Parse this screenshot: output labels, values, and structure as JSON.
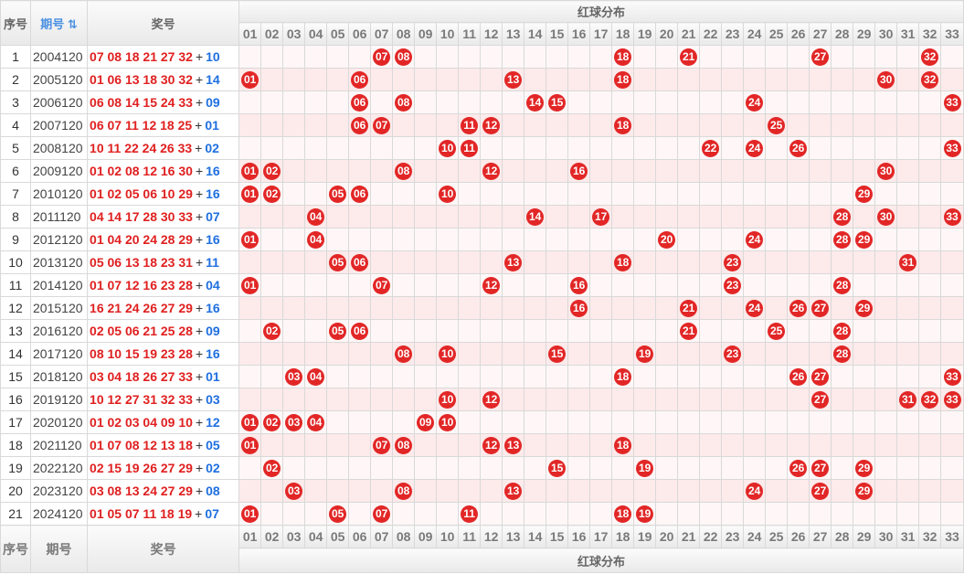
{
  "header": {
    "seq": "序号",
    "period": "期号",
    "sort_icon": "⇅",
    "numbers": "奖号",
    "group": "红球分布"
  },
  "columns": [
    "01",
    "02",
    "03",
    "04",
    "05",
    "06",
    "07",
    "08",
    "09",
    "10",
    "11",
    "12",
    "13",
    "14",
    "15",
    "16",
    "17",
    "18",
    "19",
    "20",
    "21",
    "22",
    "23",
    "24",
    "25",
    "26",
    "27",
    "28",
    "29",
    "30",
    "31",
    "32",
    "33"
  ],
  "separators_after": [
    11,
    22
  ],
  "rows": [
    {
      "seq": "1",
      "period": "2004120",
      "red": "07 08 18 21 27 32",
      "blue": "10",
      "balls": [
        "07",
        "08",
        "18",
        "21",
        "27",
        "32"
      ]
    },
    {
      "seq": "2",
      "period": "2005120",
      "red": "01 06 13 18 30 32",
      "blue": "14",
      "balls": [
        "01",
        "06",
        "13",
        "18",
        "30",
        "32"
      ]
    },
    {
      "seq": "3",
      "period": "2006120",
      "red": "06 08 14 15 24 33",
      "blue": "09",
      "balls": [
        "06",
        "08",
        "14",
        "15",
        "24",
        "33"
      ]
    },
    {
      "seq": "4",
      "period": "2007120",
      "red": "06 07 11 12 18 25",
      "blue": "01",
      "balls": [
        "06",
        "07",
        "11",
        "12",
        "18",
        "25"
      ]
    },
    {
      "seq": "5",
      "period": "2008120",
      "red": "10 11 22 24 26 33",
      "blue": "02",
      "balls": [
        "10",
        "11",
        "22",
        "24",
        "26",
        "33"
      ]
    },
    {
      "seq": "6",
      "period": "2009120",
      "red": "01 02 08 12 16 30",
      "blue": "16",
      "balls": [
        "01",
        "02",
        "08",
        "12",
        "16",
        "30"
      ]
    },
    {
      "seq": "7",
      "period": "2010120",
      "red": "01 02 05 06 10 29",
      "blue": "16",
      "balls": [
        "01",
        "02",
        "05",
        "06",
        "10",
        "29"
      ]
    },
    {
      "seq": "8",
      "period": "2011120",
      "red": "04 14 17 28 30 33",
      "blue": "07",
      "balls": [
        "04",
        "14",
        "17",
        "28",
        "30",
        "33"
      ]
    },
    {
      "seq": "9",
      "period": "2012120",
      "red": "01 04 20 24 28 29",
      "blue": "16",
      "balls": [
        "01",
        "04",
        "20",
        "24",
        "28",
        "29"
      ]
    },
    {
      "seq": "10",
      "period": "2013120",
      "red": "05 06 13 18 23 31",
      "blue": "11",
      "balls": [
        "05",
        "06",
        "13",
        "18",
        "23",
        "31"
      ]
    },
    {
      "seq": "11",
      "period": "2014120",
      "red": "01 07 12 16 23 28",
      "blue": "04",
      "balls": [
        "01",
        "07",
        "12",
        "16",
        "23",
        "28"
      ]
    },
    {
      "seq": "12",
      "period": "2015120",
      "red": "16 21 24 26 27 29",
      "blue": "16",
      "balls": [
        "16",
        "21",
        "24",
        "26",
        "27",
        "29"
      ]
    },
    {
      "seq": "13",
      "period": "2016120",
      "red": "02 05 06 21 25 28",
      "blue": "09",
      "balls": [
        "02",
        "05",
        "06",
        "21",
        "25",
        "28"
      ]
    },
    {
      "seq": "14",
      "period": "2017120",
      "red": "08 10 15 19 23 28",
      "blue": "16",
      "balls": [
        "08",
        "10",
        "15",
        "19",
        "23",
        "28"
      ]
    },
    {
      "seq": "15",
      "period": "2018120",
      "red": "03 04 18 26 27 33",
      "blue": "01",
      "balls": [
        "03",
        "04",
        "18",
        "26",
        "27",
        "33"
      ]
    },
    {
      "seq": "16",
      "period": "2019120",
      "red": "10 12 27 31 32 33",
      "blue": "03",
      "balls": [
        "10",
        "12",
        "27",
        "31",
        "32",
        "33"
      ]
    },
    {
      "seq": "17",
      "period": "2020120",
      "red": "01 02 03 04 09 10",
      "blue": "12",
      "balls": [
        "01",
        "02",
        "03",
        "04",
        "09",
        "10"
      ]
    },
    {
      "seq": "18",
      "period": "2021120",
      "red": "01 07 08 12 13 18",
      "blue": "05",
      "balls": [
        "01",
        "07",
        "08",
        "12",
        "13",
        "18"
      ]
    },
    {
      "seq": "19",
      "period": "2022120",
      "red": "02 15 19 26 27 29",
      "blue": "02",
      "balls": [
        "02",
        "15",
        "19",
        "26",
        "27",
        "29"
      ]
    },
    {
      "seq": "20",
      "period": "2023120",
      "red": "03 08 13 24 27 29",
      "blue": "08",
      "balls": [
        "03",
        "08",
        "13",
        "24",
        "27",
        "29"
      ]
    },
    {
      "seq": "21",
      "period": "2024120",
      "red": "01 05 07 11 18 19",
      "blue": "07",
      "balls": [
        "01",
        "05",
        "07",
        "11",
        "18",
        "19"
      ]
    }
  ],
  "footer": {
    "seq": "序号",
    "period": "期号",
    "numbers": "奖号",
    "group": "红球分布"
  },
  "colors": {
    "red_ball": "#e22626",
    "blue_number": "#1f6fe0",
    "red_number": "#e02020"
  }
}
